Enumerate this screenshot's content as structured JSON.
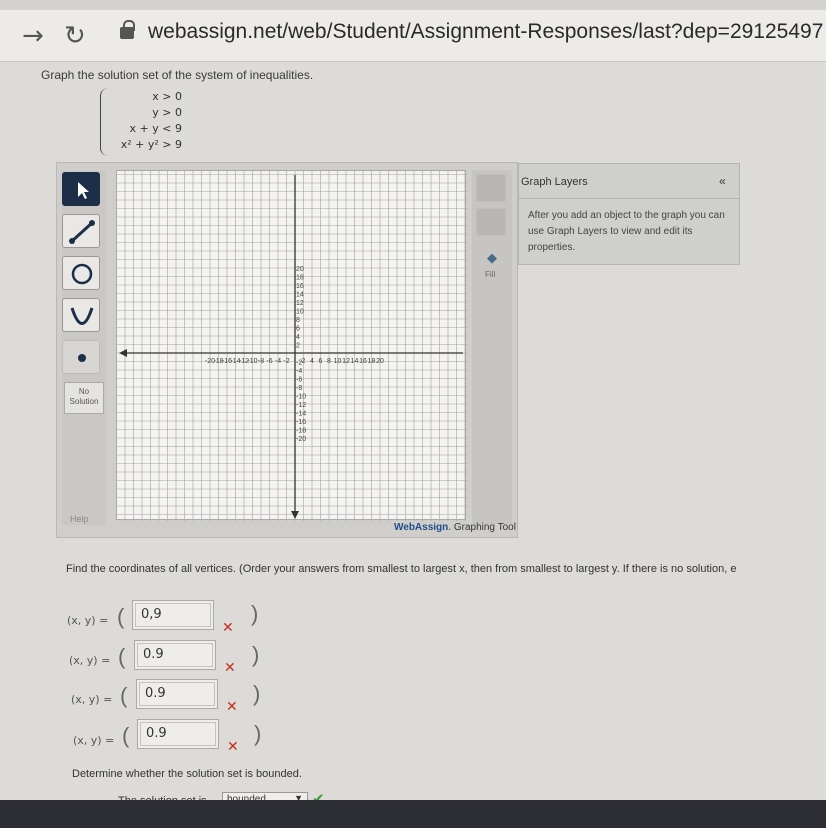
{
  "browser": {
    "back_icon": "arrow-right",
    "reload_icon": "reload",
    "url": "webassign.net/web/Student/Assignment-Responses/last?dep=29125497"
  },
  "question": {
    "prompt": "Graph the solution set of the system of inequalities.",
    "inequalities": [
      "x > 0",
      "y > 0",
      "x + y < 9",
      "x² + y² > 9"
    ]
  },
  "graph_tool": {
    "tools": [
      "pointer-tool",
      "line-tool",
      "circle-tool",
      "parabola-tool",
      "point-tool"
    ],
    "no_solution_label": "No Solution",
    "help_label": "Help",
    "fill_label": "Fill",
    "brand_bold": "WebAssign",
    "brand_rest": ". Graphing Tool",
    "x_ticks": [
      "-20",
      "-18",
      "-16",
      "-14",
      "-12",
      "-10",
      "-8",
      "-6",
      "-4",
      "-2",
      "2",
      "4",
      "6",
      "8",
      "10",
      "12",
      "14",
      "16",
      "18",
      "20"
    ],
    "y_ticks": [
      "20",
      "18",
      "16",
      "14",
      "12",
      "10",
      "8",
      "6",
      "4",
      "2",
      "-2",
      "-4",
      "-6",
      "-8",
      "-10",
      "-12",
      "-14",
      "-16",
      "-18",
      "-20"
    ]
  },
  "layers": {
    "title": "Graph Layers",
    "collapse": "«",
    "description": "After you add an object to the graph you can use Graph Layers to view and edit its properties."
  },
  "vertices": {
    "instructions": "Find the coordinates of all vertices. (Order your answers from smallest to largest x, then from smallest to largest y. If there is no solution, e",
    "label": "(x, y) =",
    "open_paren": "(",
    "close_paren": ")",
    "answers": [
      "0,9",
      "0.9",
      "0.9",
      "0.9"
    ],
    "status_mark": "✕"
  },
  "bounded": {
    "question": "Determine whether the solution set is bounded.",
    "label": "The solution set is",
    "selected": "bounded",
    "status_mark": "✔"
  },
  "colors": {
    "active_tool": "#1d2f48",
    "incorrect": "#cc2a1f",
    "correct": "#3a9a3a",
    "link": "#1f4f8a"
  }
}
